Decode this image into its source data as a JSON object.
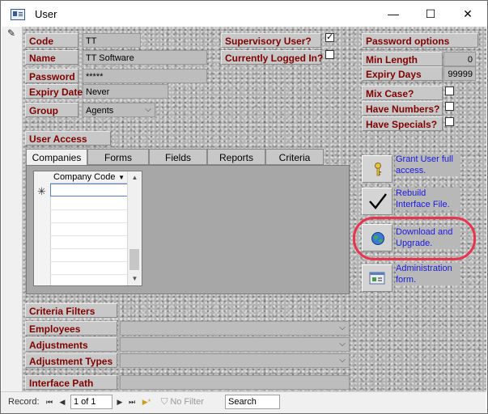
{
  "window": {
    "title": "User",
    "minimize": "—",
    "maximize": "☐",
    "close": "✕"
  },
  "fields": {
    "code": {
      "label": "Code",
      "value": "TT"
    },
    "name": {
      "label": "Name",
      "value": "TT Software"
    },
    "password": {
      "label": "Password",
      "value": "*****"
    },
    "expiry_date": {
      "label": "Expiry Date",
      "value": "Never"
    },
    "group": {
      "label": "Group",
      "value": "Agents"
    },
    "supervisor": {
      "label": "Supervisory User?",
      "checked": true,
      "mark": "✓"
    },
    "logged_in": {
      "label": "Currently Logged In?",
      "checked": false
    }
  },
  "password_options": {
    "header": "Password options",
    "min_length": {
      "label": "Min Length",
      "value": "0"
    },
    "expiry_days": {
      "label": "Expiry Days",
      "value": "99999"
    },
    "mix_case": {
      "label": "Mix Case?",
      "checked": false
    },
    "have_numbers": {
      "label": "Have Numbers?",
      "checked": false
    },
    "have_specials": {
      "label": "Have Specials?",
      "checked": false
    }
  },
  "user_access": {
    "header": "User Access",
    "tabs": [
      "Companies",
      "Forms",
      "Fields",
      "Reports",
      "Criteria"
    ],
    "active_tab": "Companies",
    "grid": {
      "column": "Company Code",
      "new_row_marker": "✳",
      "rows": []
    }
  },
  "actions": [
    {
      "label": "Grant User full access.",
      "icon": "key-icon"
    },
    {
      "label": "Rebuild Interface File.",
      "icon": "checkmark-icon"
    },
    {
      "label": "Download and Upgrade.",
      "icon": "globe-icon"
    },
    {
      "label": "Administration form.",
      "icon": "admin-form-icon"
    }
  ],
  "highlight_color": "#e8344d",
  "criteria_filters": {
    "header": "Criteria Filters",
    "employees": {
      "label": "Employees",
      "value": ""
    },
    "adjustments": {
      "label": "Adjustments",
      "value": ""
    },
    "adjustment_types": {
      "label": "Adjustment Types",
      "value": ""
    }
  },
  "interface_path": {
    "label": "Interface Path",
    "value": ""
  },
  "record_nav": {
    "label": "Record:",
    "first": "⏮",
    "prev": "◀",
    "current": "1 of 1",
    "next": "▶",
    "last": "⏭",
    "new": "▶*",
    "filter_label": "No Filter",
    "search_placeholder": "Search"
  }
}
